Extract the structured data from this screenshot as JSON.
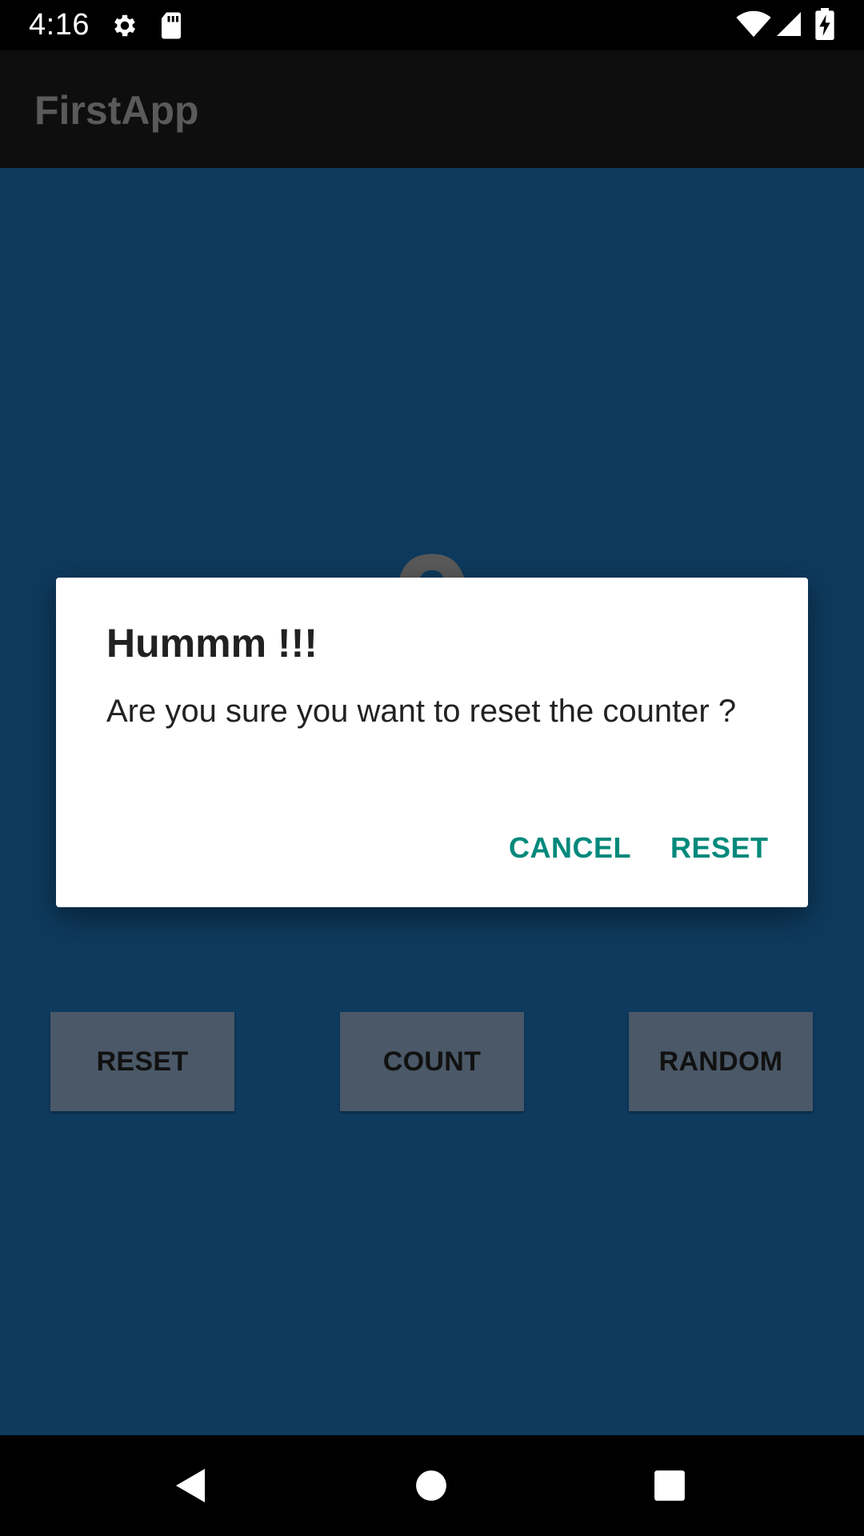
{
  "status_bar": {
    "time": "4:16",
    "icons": [
      "gear-icon",
      "sd-card-icon",
      "wifi-icon",
      "signal-icon",
      "battery-charging-icon"
    ]
  },
  "app_bar": {
    "title": "FirstApp"
  },
  "main": {
    "counter_value": "0",
    "buttons": [
      {
        "label": "RESET"
      },
      {
        "label": "COUNT"
      },
      {
        "label": "RANDOM"
      }
    ]
  },
  "dialog": {
    "title": "Hummm !!!",
    "message": "Are you sure you want to reset the counter ?",
    "cancel_label": "CANCEL",
    "confirm_label": "RESET"
  },
  "nav_bar": {
    "icons": [
      "back-icon",
      "home-icon",
      "recents-icon"
    ]
  },
  "colors": {
    "content_background": "#0e3a5e",
    "app_bar_background": "#0e0e0e",
    "button_background": "#4a5867",
    "dialog_accent": "#00897b"
  }
}
